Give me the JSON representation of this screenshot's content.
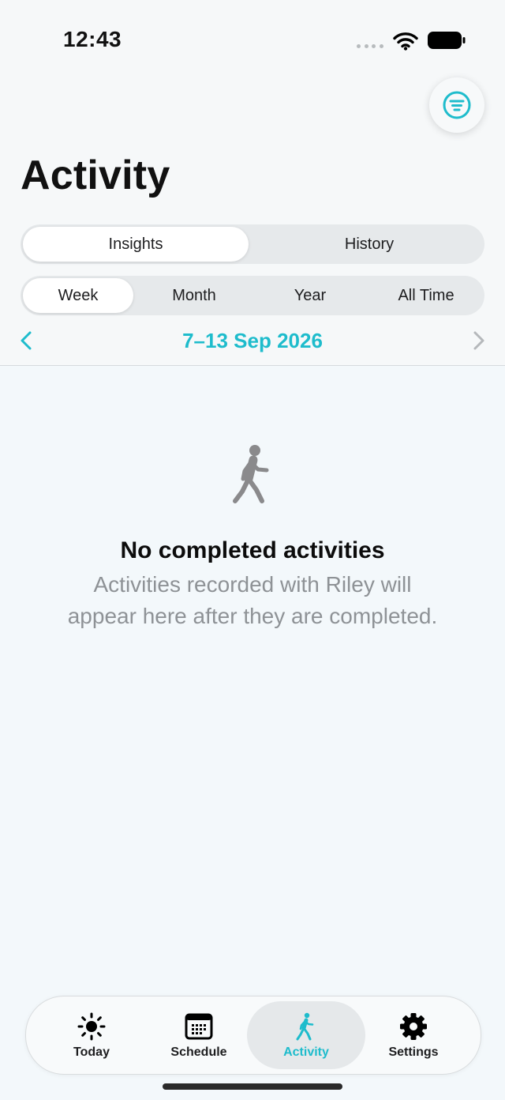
{
  "status_bar": {
    "time": "12:43"
  },
  "header": {
    "title": "Activity",
    "filter_icon": "filter-lines-icon"
  },
  "view_tabs": {
    "options": [
      "Insights",
      "History"
    ],
    "selected": "Insights"
  },
  "period_tabs": {
    "options": [
      "Week",
      "Month",
      "Year",
      "All Time"
    ],
    "selected": "Week"
  },
  "date_nav": {
    "range": "7–13 Sep 2026",
    "prev_icon": "chevron-left-icon",
    "next_icon": "chevron-right-icon"
  },
  "empty_state": {
    "icon": "walking-person-icon",
    "title": "No completed activities",
    "message": "Activities recorded with Riley will appear here after they are completed."
  },
  "tab_bar": {
    "items": [
      {
        "label": "Today",
        "icon": "sun-icon"
      },
      {
        "label": "Schedule",
        "icon": "calendar-icon"
      },
      {
        "label": "Activity",
        "icon": "walking-person-icon"
      },
      {
        "label": "Settings",
        "icon": "gear-icon"
      }
    ],
    "active": "Activity"
  },
  "colors": {
    "accent": "#1ebccc",
    "muted_text": "#8e9296",
    "icon_gray": "#8a8a8c",
    "background": "#f3f8fb"
  }
}
